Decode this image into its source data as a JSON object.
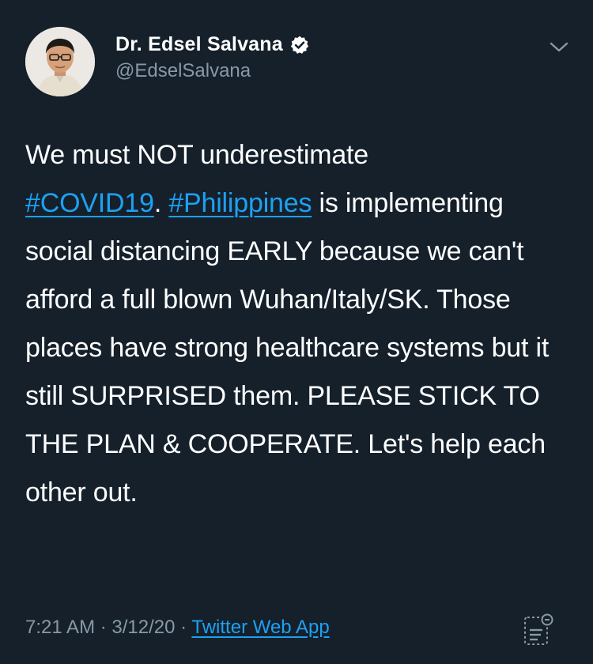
{
  "author": {
    "display_name": "Dr. Edsel Salvana",
    "handle": "@EdselSalvana",
    "verified": true,
    "avatar_icon": "profile-photo"
  },
  "tweet": {
    "line1_text": "We must NOT underestimate",
    "hashtag_covid": "#COVID19",
    "text_between_hashtags": ".",
    "hashtag_philippines": "#Philippines",
    "text_after_hashtag": " is",
    "body_text": "implementing social distancing EARLY because we can't afford a full blown Wuhan/Italy/SK. Those places have strong healthcare systems but it still SURPRISED them. PLEASE STICK TO THE PLAN & COOPERATE. Let's help each other out."
  },
  "meta": {
    "time": "7:21 AM",
    "separator": "·",
    "date": "3/12/20",
    "source": "Twitter Web App"
  },
  "icons": {
    "menu": "chevron-down-icon",
    "analytics": "analytics-icon",
    "verified": "verified-badge-icon"
  },
  "colors": {
    "background": "#15202b",
    "text": "#ffffff",
    "secondary": "#8899a6",
    "link": "#1da1f2"
  }
}
